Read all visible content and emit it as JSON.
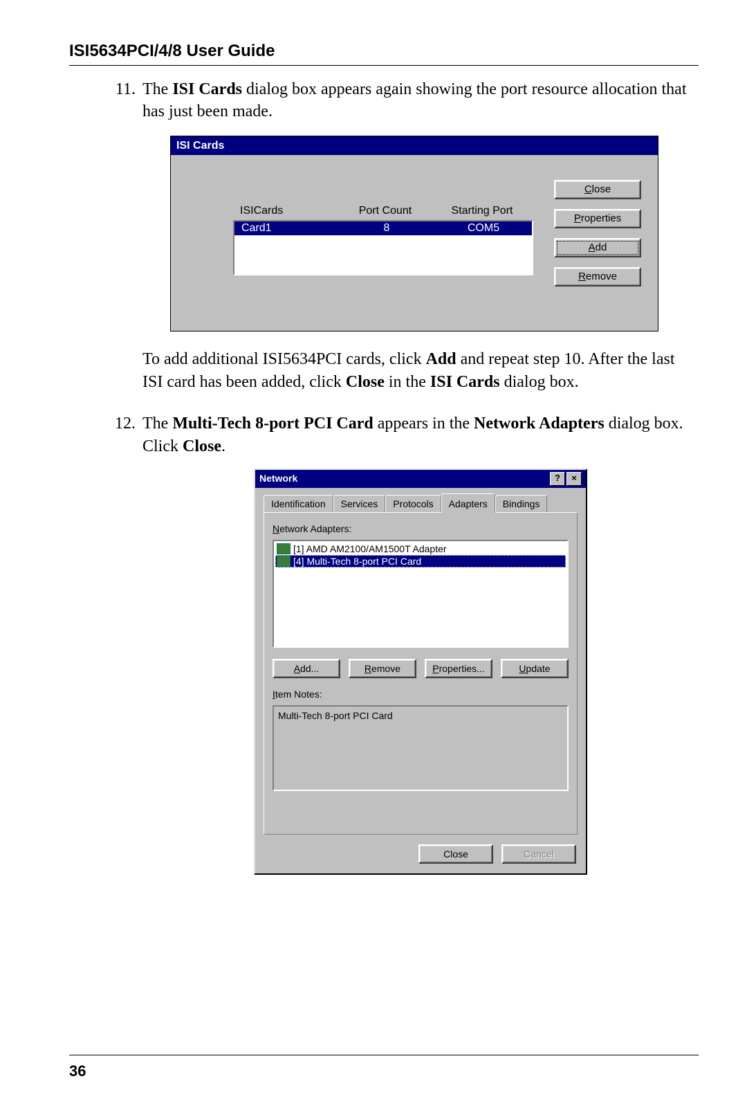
{
  "header": {
    "title": "ISI5634PCI/4/8 User Guide"
  },
  "page_number": "36",
  "step11": {
    "num": "11.",
    "intro_pre": "The ",
    "intro_bold": "ISI Cards",
    "intro_post": " dialog box appears again showing the port resource allocation that has just been made.",
    "outro_1a": "To add additional ISI5634PCI cards, click ",
    "outro_1_bold_add": "Add",
    "outro_1b": " and repeat step 10. After the last ISI card has been added, click ",
    "outro_1_bold_close": "Close",
    "outro_1c": " in the ",
    "outro_1_bold_isi": "ISI Cards",
    "outro_1d": " dialog box."
  },
  "step12": {
    "num": "12.",
    "a": "The ",
    "b_bold": "Multi-Tech 8-port PCI Card",
    "c": " appears in the ",
    "d_bold": "Network Adapters",
    "e": " dialog box. Click ",
    "f_bold": "Close",
    "g": "."
  },
  "isi_dialog": {
    "title": "ISI Cards",
    "columns": {
      "c1": "ISICards",
      "c2": "Port Count",
      "c3": "Starting Port"
    },
    "row": {
      "c1": "Card1",
      "c2": "8",
      "c3": "COM5"
    },
    "buttons": {
      "close_pre": "C",
      "close_rest": "lose",
      "props_pre": "P",
      "props_rest": "roperties",
      "add_pre": "A",
      "add_rest": "dd",
      "remove_pre": "R",
      "remove_rest": "emove"
    }
  },
  "net_dialog": {
    "title": "Network",
    "help": "?",
    "x": "×",
    "tabs": {
      "t1": "Identification",
      "t2": "Services",
      "t3": "Protocols",
      "t4": "Adapters",
      "t5": "Bindings"
    },
    "list_label_pre": "N",
    "list_label_rest": "etwork Adapters:",
    "items": {
      "i1": "[1] AMD AM2100/AM1500T Adapter",
      "i2": "[4] Multi-Tech 8-port PCI Card"
    },
    "buttons": {
      "add_pre": "A",
      "add_rest": "dd...",
      "remove_pre": "R",
      "remove_rest": "emove",
      "props_pre": "P",
      "props_rest": "roperties...",
      "update_pre": "U",
      "update_rest": "pdate"
    },
    "notes_label_pre": "I",
    "notes_label_rest": "tem Notes:",
    "notes_text": "Multi-Tech 8-port PCI Card",
    "footer": {
      "close": "Close",
      "cancel": "Cancel"
    }
  }
}
